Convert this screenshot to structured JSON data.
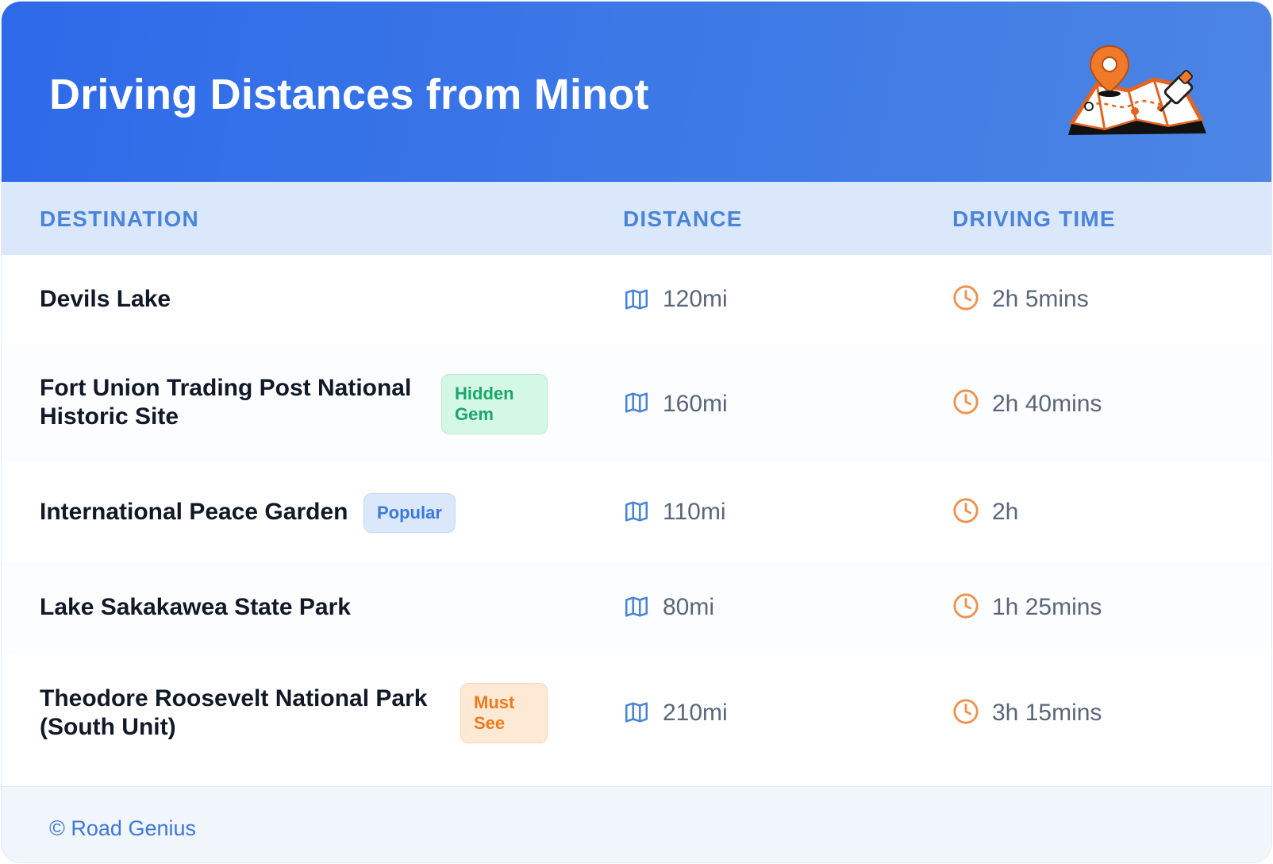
{
  "header": {
    "title": "Driving Distances from Minot",
    "icon": "map-pin-icon"
  },
  "columns": {
    "destination": "DESTINATION",
    "distance": "DISTANCE",
    "driving_time": "DRIVING TIME"
  },
  "rows": [
    {
      "destination": "Devils Lake",
      "badge": "",
      "distance": "120mi",
      "time": "2h 5mins"
    },
    {
      "destination": "Fort Union Trading Post National Historic Site",
      "badge": "Hidden Gem",
      "distance": "160mi",
      "time": "2h 40mins"
    },
    {
      "destination": "International Peace Garden",
      "badge": "Popular",
      "distance": "110mi",
      "time": "2h"
    },
    {
      "destination": "Lake Sakakawea State Park",
      "badge": "",
      "distance": "80mi",
      "time": "1h 25mins"
    },
    {
      "destination": "Theodore Roosevelt National Park (South Unit)",
      "badge": "Must See",
      "distance": "210mi",
      "time": "3h 15mins"
    }
  ],
  "icons": {
    "distance": "map-icon",
    "time": "clock-icon"
  },
  "colors": {
    "header": "#2e6ae8",
    "accent": "#3d78dc",
    "clock": "#f0904a",
    "hidden_gem": "#1aa86a",
    "popular": "#3d78dc",
    "must_see": "#ee7a1c"
  },
  "footer": {
    "text": "© Road Genius"
  }
}
